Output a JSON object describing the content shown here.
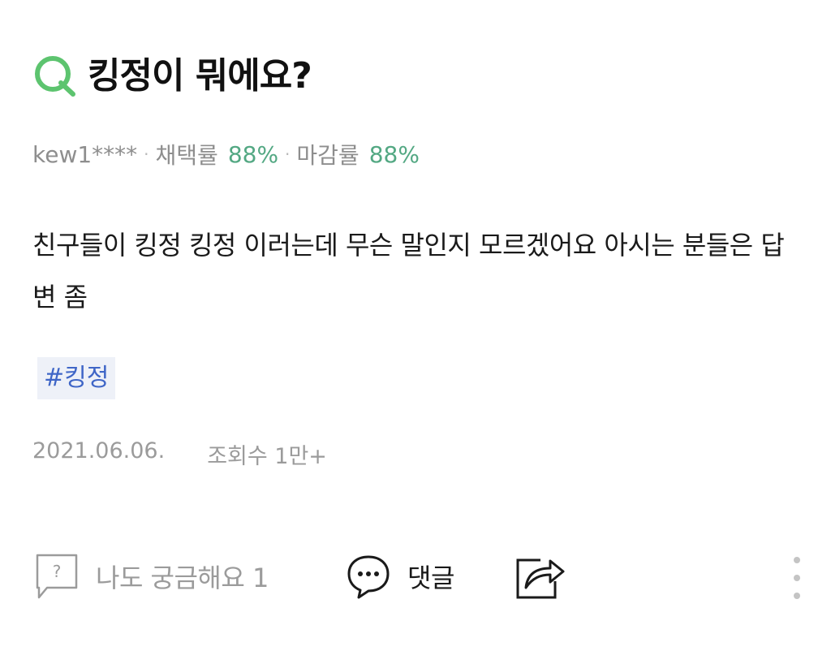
{
  "question": {
    "icon": "q-icon",
    "title": "킹정이 뭐에요?"
  },
  "meta": {
    "author": "kew1****",
    "adoption_label": "채택률",
    "adoption_rate": "88%",
    "closing_label": "마감률",
    "closing_rate": "88%"
  },
  "body": {
    "text": "친구들이 킹정 킹정 이러는데 무슨 말인지 모르겠어요 아시는 분들은 답변 좀"
  },
  "tags": [
    "#킹정"
  ],
  "info": {
    "date": "2021.06.06.",
    "views": "조회수 1만+"
  },
  "actions": {
    "curious_label": "나도 궁금해요 1",
    "comment_label": "댓글",
    "icons": [
      "question-bubble-icon",
      "speech-bubble-icon",
      "share-icon",
      "more-vertical-icon"
    ]
  },
  "colors": {
    "accent_green": "#53a883",
    "q_green": "#5dc46f",
    "tag_blue": "#3f66c7",
    "tag_bg": "#eef1f8",
    "muted": "#9b9b9b"
  }
}
